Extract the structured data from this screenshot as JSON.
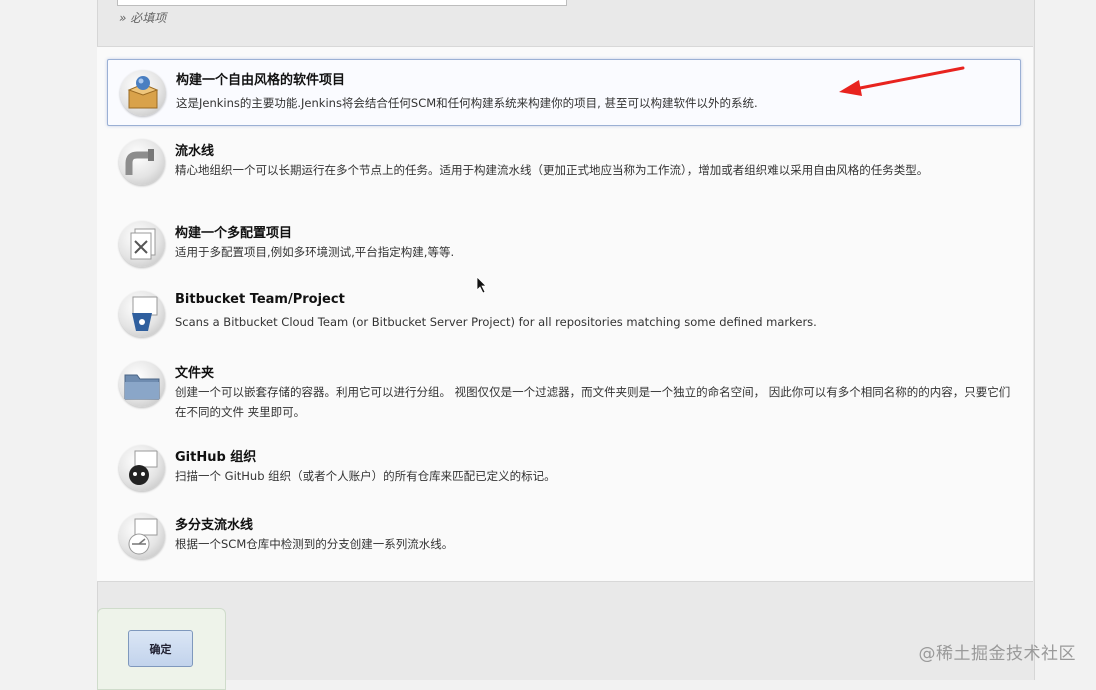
{
  "form": {
    "required_note": "» 必填项",
    "ok_button": "确定"
  },
  "items": [
    {
      "title": "构建一个自由风格的软件项目",
      "desc": "这是Jenkins的主要功能.Jenkins将会结合任何SCM和任何构建系统来构建你的项目, 甚至可以构建软件以外的系统.",
      "icon": "freestyle-project-icon",
      "selected": true
    },
    {
      "title": "流水线",
      "desc": "精心地组织一个可以长期运行在多个节点上的任务。适用于构建流水线（更加正式地应当称为工作流），增加或者组织难以采用自由风格的任务类型。",
      "icon": "pipeline-icon"
    },
    {
      "title": "构建一个多配置项目",
      "desc": "适用于多配置项目,例如多环境测试,平台指定构建,等等.",
      "icon": "multi-config-project-icon"
    },
    {
      "title": "Bitbucket Team/Project",
      "desc": "Scans a Bitbucket Cloud Team (or Bitbucket Server Project) for all repositories matching some defined markers.",
      "icon": "bitbucket-icon"
    },
    {
      "title": "文件夹",
      "desc": "创建一个可以嵌套存储的容器。利用它可以进行分组。 视图仅仅是一个过滤器，而文件夹则是一个独立的命名空间， 因此你可以有多个相同名称的的内容，只要它们在不同的文件 夹里即可。",
      "icon": "folder-icon"
    },
    {
      "title": "GitHub 组织",
      "desc": "扫描一个 GitHub 组织（或者个人账户）的所有仓库来匹配已定义的标记。",
      "icon": "github-organization-icon"
    },
    {
      "title": "多分支流水线",
      "desc": "根据一个SCM仓库中检测到的分支创建一系列流水线。",
      "icon": "multibranch-pipeline-icon"
    }
  ],
  "watermark": "@稀土掘金技术社区",
  "colors": {
    "selected_border": "#9bb0d4",
    "arrow": "#e8231f",
    "button": "#c2d3ec"
  }
}
